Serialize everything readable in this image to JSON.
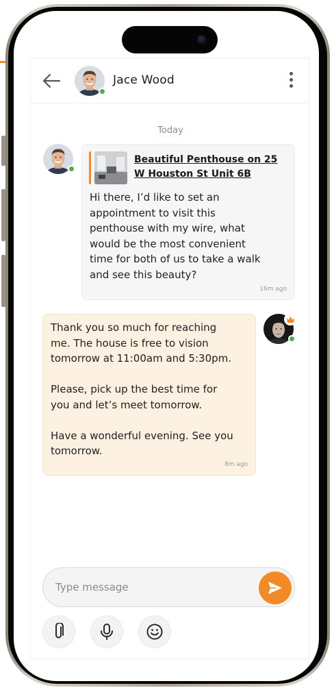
{
  "header": {
    "contact_name": "Jace Wood"
  },
  "chat": {
    "date_separator": "Today",
    "messages": [
      {
        "direction": "incoming",
        "listing_title": "Beautiful Penthouse on 25 W Houston St Unit 6B",
        "lines": [
          "Hi there, I’d like to set an",
          "appointment to visit this",
          "penthouse with my wire, what",
          "would be the most convenient",
          "time for both of us to take a walk",
          "and see this beauty?"
        ],
        "time": "16m ago"
      },
      {
        "direction": "outgoing",
        "lines": [
          "Thank you so much for reaching",
          "me. The house is free to vision",
          "tomorrow at 11:00am and 5:30pm.",
          "",
          "Please, pick up the best time for",
          "you and let’s meet tomorrow.",
          "",
          "Have a wonderful evening. See you",
          "tomorrow."
        ],
        "time": "8m ago"
      }
    ]
  },
  "composer": {
    "placeholder": "Type message"
  },
  "icons": {
    "back": "arrow-left-icon",
    "more": "more-vertical-icon",
    "send": "send-icon",
    "attach": "paperclip-icon",
    "voice": "microphone-icon",
    "emoji": "smiley-icon",
    "badge": "crown-icon"
  },
  "colors": {
    "accent": "#f28a28",
    "online": "#4caf50",
    "incoming_bubble": "#f6f6f6",
    "outgoing_bubble": "#fdf1e2"
  }
}
